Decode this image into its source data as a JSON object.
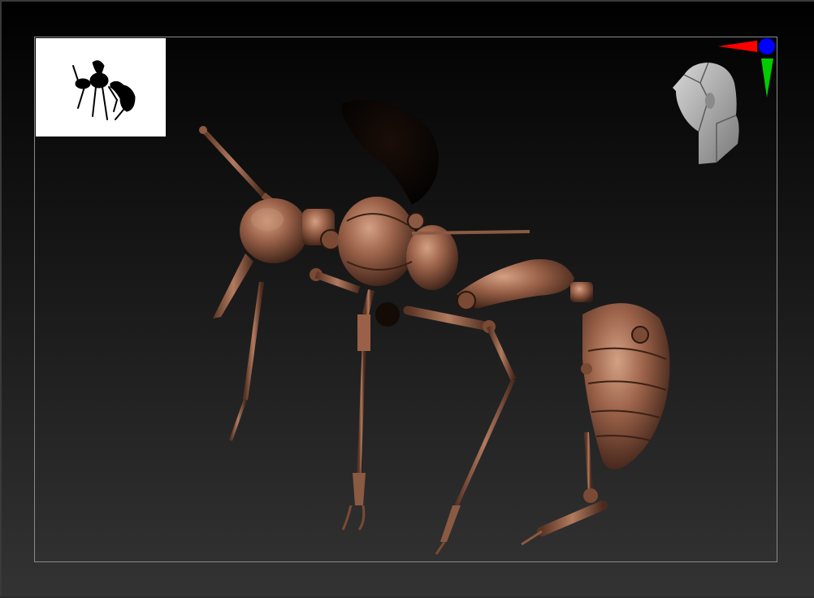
{
  "viewport": {
    "background_top": "#000000",
    "background_bottom": "#333333",
    "frame_color": "#8a8a8a"
  },
  "thumbnail": {
    "background": "#ffffff",
    "silhouette_color": "#000000"
  },
  "model": {
    "subject": "mechanical-ant-icon",
    "material_color": "#8a5a42",
    "highlight_color": "#c48a6a",
    "shadow_color": "#2a160e"
  },
  "navigation_gizmo": {
    "head": "head-icon",
    "x_axis_color": "#ff0000",
    "y_axis_color": "#00cc00",
    "z_axis_color": "#0000ff"
  }
}
